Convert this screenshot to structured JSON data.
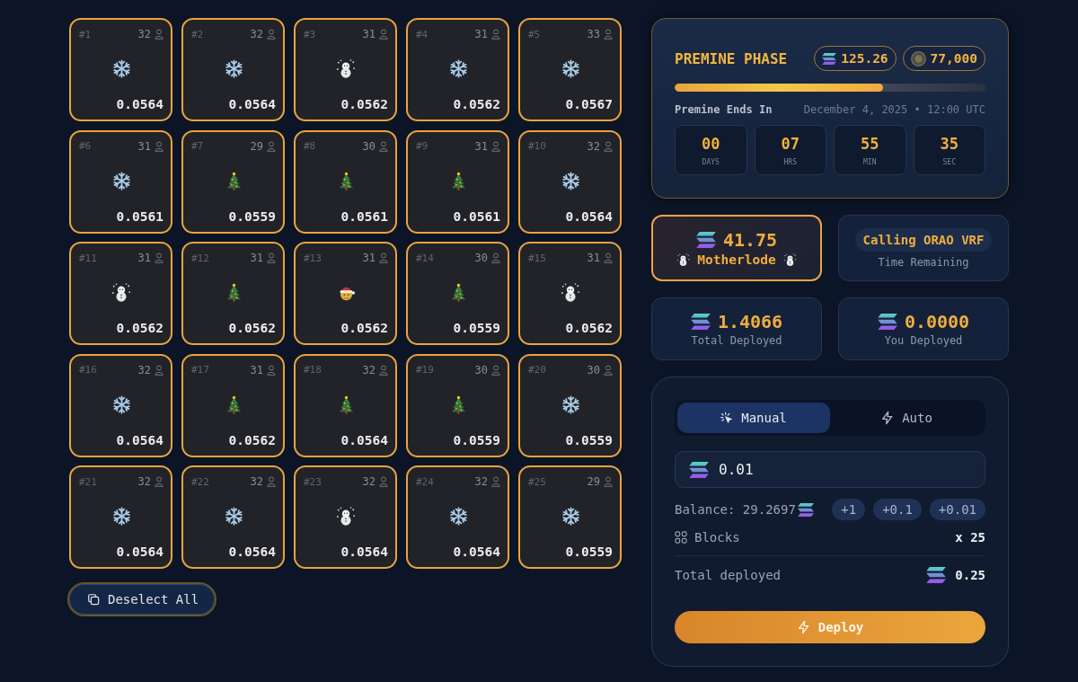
{
  "grid": {
    "cells": [
      {
        "label": "#1",
        "count": "32",
        "kind": "snowflake",
        "value": "0.0564",
        "selected": true
      },
      {
        "label": "#2",
        "count": "32",
        "kind": "snowflake",
        "value": "0.0564",
        "selected": true
      },
      {
        "label": "#3",
        "count": "31",
        "kind": "snowman",
        "value": "0.0562",
        "selected": true
      },
      {
        "label": "#4",
        "count": "31",
        "kind": "snowflake",
        "value": "0.0562",
        "selected": true
      },
      {
        "label": "#5",
        "count": "33",
        "kind": "snowflake",
        "value": "0.0567",
        "selected": true
      },
      {
        "label": "#6",
        "count": "31",
        "kind": "snowflake",
        "value": "0.0561",
        "selected": true
      },
      {
        "label": "#7",
        "count": "29",
        "kind": "tree",
        "value": "0.0559",
        "selected": true
      },
      {
        "label": "#8",
        "count": "30",
        "kind": "tree",
        "value": "0.0561",
        "selected": true
      },
      {
        "label": "#9",
        "count": "31",
        "kind": "tree",
        "value": "0.0561",
        "selected": true
      },
      {
        "label": "#10",
        "count": "32",
        "kind": "snowflake",
        "value": "0.0564",
        "selected": true
      },
      {
        "label": "#11",
        "count": "31",
        "kind": "snowman",
        "value": "0.0562",
        "selected": true
      },
      {
        "label": "#12",
        "count": "31",
        "kind": "tree",
        "value": "0.0562",
        "selected": true
      },
      {
        "label": "#13",
        "count": "31",
        "kind": "santa",
        "value": "0.0562",
        "selected": true
      },
      {
        "label": "#14",
        "count": "30",
        "kind": "tree",
        "value": "0.0559",
        "selected": true
      },
      {
        "label": "#15",
        "count": "31",
        "kind": "snowman",
        "value": "0.0562",
        "selected": true
      },
      {
        "label": "#16",
        "count": "32",
        "kind": "snowflake",
        "value": "0.0564",
        "selected": true
      },
      {
        "label": "#17",
        "count": "31",
        "kind": "tree",
        "value": "0.0562",
        "selected": true
      },
      {
        "label": "#18",
        "count": "32",
        "kind": "tree",
        "value": "0.0564",
        "selected": true
      },
      {
        "label": "#19",
        "count": "30",
        "kind": "tree",
        "value": "0.0559",
        "selected": true
      },
      {
        "label": "#20",
        "count": "30",
        "kind": "snowflake",
        "value": "0.0559",
        "selected": true
      },
      {
        "label": "#21",
        "count": "32",
        "kind": "snowflake",
        "value": "0.0564",
        "selected": true
      },
      {
        "label": "#22",
        "count": "32",
        "kind": "snowflake",
        "value": "0.0564",
        "selected": true
      },
      {
        "label": "#23",
        "count": "32",
        "kind": "snowman",
        "value": "0.0564",
        "selected": true
      },
      {
        "label": "#24",
        "count": "32",
        "kind": "snowflake",
        "value": "0.0564",
        "selected": true
      },
      {
        "label": "#25",
        "count": "29",
        "kind": "snowflake",
        "value": "0.0559",
        "selected": true
      }
    ]
  },
  "deselect_button": {
    "label": "Deselect All"
  },
  "premine": {
    "title": "PREMINE PHASE",
    "badges": [
      {
        "kind": "sol",
        "value": "125.26"
      },
      {
        "kind": "coin",
        "value": "77,000"
      }
    ],
    "progress": {
      "level": 0.67
    },
    "ends_label": "Premine Ends In",
    "ends_at": "December 4, 2025 • 12:00 UTC",
    "countdown": [
      {
        "value": "00",
        "unit": "DAYS"
      },
      {
        "value": "07",
        "unit": "HRS"
      },
      {
        "value": "55",
        "unit": "MIN"
      },
      {
        "value": "35",
        "unit": "SEC"
      }
    ]
  },
  "motherlode": {
    "amount": "41.75",
    "label": "Motherlode"
  },
  "status": {
    "pill": "Calling ORAO VRF",
    "caption": "Time Remaining"
  },
  "stats": [
    {
      "value": "1.4066",
      "label": "Total Deployed"
    },
    {
      "value": "0.0000",
      "label": "You Deployed"
    }
  ],
  "deploy_panel": {
    "tabs": [
      {
        "kind": "manual",
        "label": "Manual",
        "selected": true
      },
      {
        "kind": "auto",
        "label": "Auto",
        "selected": false
      }
    ],
    "amount_input": {
      "value": "0.01"
    },
    "balance": "Balance: 29.2697",
    "increments": [
      "+1",
      "+0.1",
      "+0.01"
    ],
    "blocks": {
      "label": "Blocks",
      "value": "x 25"
    },
    "total": {
      "label": "Total deployed",
      "value": "0.25"
    },
    "deploy_button": {
      "label": "Deploy"
    }
  }
}
